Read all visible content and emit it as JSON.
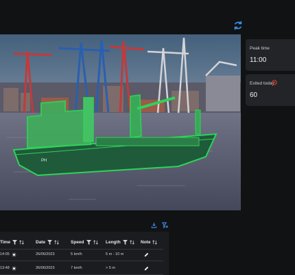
{
  "camera": {
    "description_icon": "refresh-icon",
    "scene": "container-port",
    "highlight_color": "#2fd35a"
  },
  "stats": {
    "peak_time_label": "Peak time",
    "peak_time_value": "11:00",
    "exited_today_label": "Exited today",
    "exited_today_value": "60",
    "exited_icon": "exit-arrow-icon",
    "exited_icon_color": "#e0473f"
  },
  "table": {
    "toolbar_icons": [
      "export-icon",
      "clear-filter-icon"
    ],
    "columns": [
      "Time",
      "Date",
      "Speed",
      "Length",
      "Note"
    ],
    "rows": [
      {
        "time": "14:05",
        "weather": "sun-icon",
        "date": "26/06/2023",
        "speed": "5 km/h",
        "length": "5 m - 10 m",
        "note": "edit-icon"
      },
      {
        "time": "13:48",
        "weather": "sun-icon",
        "date": "26/06/2023",
        "speed": "7 km/h",
        "length": "> 5 m",
        "note": "edit-icon"
      }
    ]
  },
  "colors": {
    "accent": "#3a8eea",
    "background": "#111214",
    "card": "#232427"
  }
}
